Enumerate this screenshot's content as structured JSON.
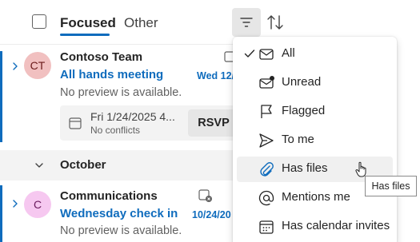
{
  "header": {
    "tabs": [
      {
        "label": "Focused",
        "active": true
      },
      {
        "label": "Other",
        "active": false
      }
    ]
  },
  "messages": [
    {
      "initials": "CT",
      "avatar_color": "#f1c0c0",
      "sender": "Contoso Team",
      "subject": "All hands meeting",
      "date": "Wed 12/",
      "preview": "No preview is available.",
      "invite": {
        "date": "Fri 1/24/2025 4...",
        "conflicts": "No conflicts",
        "rsvp_label": "RSVP"
      }
    },
    {
      "initials": "C",
      "avatar_color": "#f6c8f0",
      "sender": "Communications",
      "subject": "Wednesday check in",
      "date": "10/24/20",
      "preview": "No preview is available."
    }
  ],
  "group": {
    "label": "October"
  },
  "filter_menu": {
    "selected": "All",
    "hovered": "Has files",
    "items": [
      {
        "label": "All",
        "icon": "mail-icon"
      },
      {
        "label": "Unread",
        "icon": "mail-unread-icon"
      },
      {
        "label": "Flagged",
        "icon": "flag-icon"
      },
      {
        "label": "To me",
        "icon": "send-icon"
      },
      {
        "label": "Has files",
        "icon": "paperclip-icon"
      },
      {
        "label": "Mentions me",
        "icon": "at-icon"
      },
      {
        "label": "Has calendar invites",
        "icon": "calendar-icon"
      }
    ]
  },
  "tooltip": "Has files",
  "colors": {
    "accent": "#0f6cbd",
    "menu_hover": "#f0f0f0"
  }
}
